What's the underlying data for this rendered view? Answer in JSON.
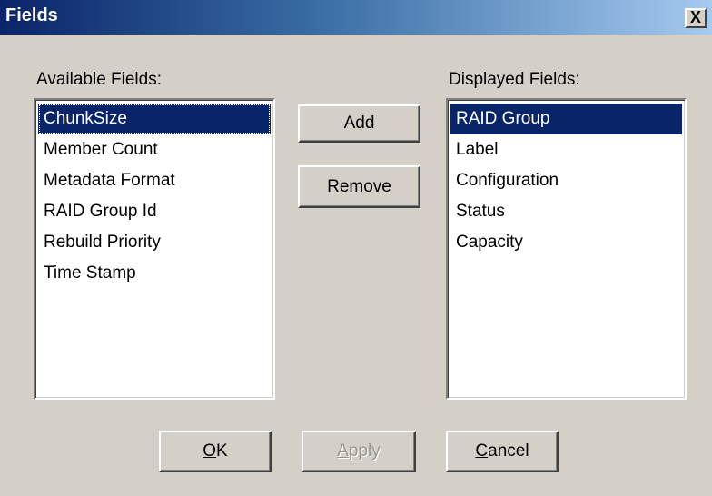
{
  "window": {
    "title": "Fields",
    "close_label": "X"
  },
  "available": {
    "label": "Available Fields:",
    "items": [
      "ChunkSize",
      "Member Count",
      "Metadata Format",
      "RAID Group Id",
      "Rebuild Priority",
      "Time Stamp"
    ],
    "selected_index": 0
  },
  "displayed": {
    "label": "Displayed Fields:",
    "items": [
      "RAID Group",
      "Label",
      "Configuration",
      "Status",
      "Capacity"
    ],
    "selected_index": 0
  },
  "buttons": {
    "add": "Add",
    "remove": "Remove",
    "ok_mnemonic": "O",
    "ok_rest": "K",
    "apply_mnemonic": "A",
    "apply_rest": "pply",
    "cancel_mnemonic": "C",
    "cancel_rest": "ancel"
  },
  "colors": {
    "selection": "#0a246a",
    "face": "#d4d0c8"
  }
}
